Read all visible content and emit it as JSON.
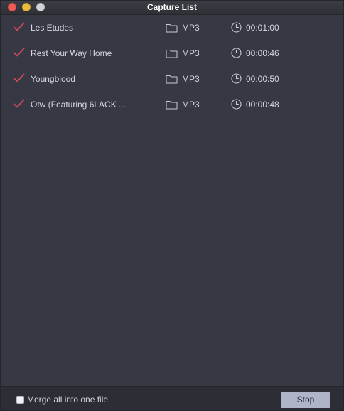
{
  "window": {
    "title": "Capture List"
  },
  "colors": {
    "background": "#363843",
    "footer": "#2d2e35",
    "check": "#d04a59",
    "text": "#d6d7de",
    "icon": "#c9cad2",
    "stop_button": "#b0b4c9"
  },
  "capture_list": {
    "items": [
      {
        "name": "Les Etudes",
        "format": "MP3",
        "duration": "00:01:00",
        "checked": true
      },
      {
        "name": "Rest Your Way Home",
        "format": "MP3",
        "duration": "00:00:46",
        "checked": true
      },
      {
        "name": "Youngblood",
        "format": "MP3",
        "duration": "00:00:50",
        "checked": true
      },
      {
        "name": "Otw (Featuring 6LACK ...",
        "format": "MP3",
        "duration": "00:00:48",
        "checked": true
      }
    ],
    "icons": {
      "check": "checkmark-icon",
      "format": "folder-icon",
      "duration": "clock-icon"
    }
  },
  "footer": {
    "merge_label": "Merge all into one file",
    "merge_checked": false,
    "stop_label": "Stop"
  }
}
